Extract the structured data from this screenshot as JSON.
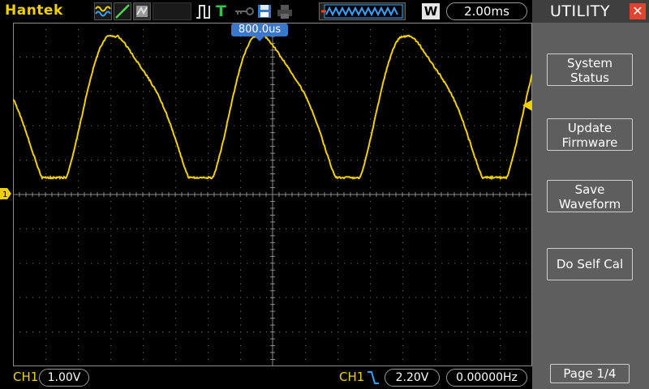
{
  "header": {
    "brand": "Hantek",
    "timebase": "2.00ms",
    "mode_letter": "W",
    "icons": [
      "acquire-wave-icon",
      "ramp-icon",
      "persistence-icon",
      "trigger-edge-icon",
      "trigger-t-icon",
      "key-icon",
      "save-icon",
      "print-icon"
    ]
  },
  "display": {
    "trigger_position": "800.0us"
  },
  "footer": {
    "ch1_label": "CH1",
    "ch1_scale": "1.00V",
    "trigger_source": "CH1",
    "trigger_level": "2.20V",
    "frequency": "0.00000Hz"
  },
  "menu": {
    "title": "UTILITY",
    "buttons": [
      {
        "line1": "System",
        "line2": "Status"
      },
      {
        "line1": "Update",
        "line2": "Firmware"
      },
      {
        "line1": "Save",
        "line2": "Waveform"
      },
      {
        "line1": "Do Self Cal",
        "line2": ""
      }
    ],
    "page": "Page 1/4"
  },
  "colors": {
    "trace": "#f0d000",
    "menu_bg": "#5e5e5e",
    "accent_blue": "#3b78c9",
    "close_red": "#e0432f"
  }
}
